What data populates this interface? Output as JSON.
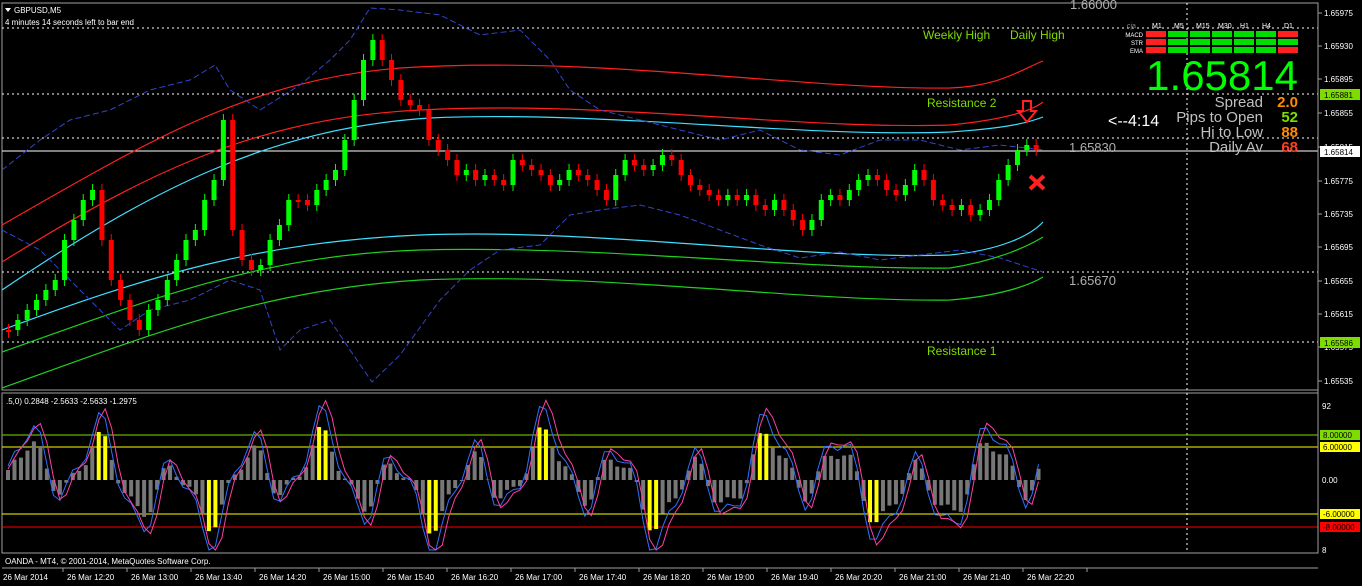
{
  "window": {
    "symbol_label": "GBPUSD,M5",
    "timer_text": "4 minutes 14 seconds left to bar end",
    "footer_text": "OANDA - MT4, © 2001-2014, MetaQuotes Software Corp."
  },
  "main_chart": {
    "price_labels": [
      "1.65975",
      "1.65930",
      "1.65895",
      "1.65855",
      "1.65815",
      "1.65775",
      "1.65735",
      "1.65695",
      "1.65655",
      "1.65615",
      "1.65575",
      "1.65535"
    ],
    "highlight_prices": [
      {
        "text": "1.65881",
        "color": "#7fdc00"
      },
      {
        "text": "1.65814",
        "color": "#ffffff"
      },
      {
        "text": "1.65586",
        "color": "#7fdc00"
      }
    ],
    "level_texts": {
      "top": "1.66000",
      "mid_high": "1.65830",
      "mid_low": "1.65670"
    },
    "labels": {
      "weekly_high": "Weekly High",
      "daily_high": "Daily High",
      "resistance_2": "Resistance 2",
      "resistance_1": "Resistance 1"
    },
    "colors": {
      "bull": "#00ff00",
      "bear": "#ff0000",
      "band_red": "#ff2020",
      "band_cyan": "#40e0ff",
      "band_green": "#20d020",
      "envelope": "#3344cc",
      "level_green": "#7fdc00"
    }
  },
  "info_panel": {
    "big_price": "1.65814",
    "countdown": "<--4:14",
    "rows": [
      {
        "label": "Spread",
        "value": "2.0",
        "color": "#ff8c00"
      },
      {
        "label": "Pips to Open",
        "value": "52",
        "color": "#7fdc00"
      },
      {
        "label": "Hi to Low",
        "value": "88",
        "color": "#ff8c00"
      },
      {
        "label": "Daily Av",
        "value": "68",
        "color": "#ff4020"
      }
    ]
  },
  "signal_grid": {
    "corner": "cja",
    "timeframes": [
      "M1",
      "M5",
      "M15",
      "M30",
      "H1",
      "H4",
      "D1"
    ],
    "rows": [
      {
        "name": "MACD",
        "cells": [
          "red",
          "green",
          "green",
          "green",
          "green",
          "green",
          "red"
        ]
      },
      {
        "name": "STR",
        "cells": [
          "red",
          "green",
          "green",
          "green",
          "green",
          "green",
          "green"
        ]
      },
      {
        "name": "EMA",
        "cells": [
          "red",
          "green",
          "green",
          "green",
          "green",
          "green",
          "red"
        ]
      }
    ]
  },
  "sub_chart": {
    "title": ".5,0) 0.2848 -2.5633 -2.5633 -1.2975",
    "scale_labels": [
      "92",
      "0.00",
      "8"
    ],
    "level_labels": [
      {
        "text": "8.00000",
        "color": "#7fdc00"
      },
      {
        "text": "6.00000",
        "color": "#ffff00"
      },
      {
        "text": "-6.00000",
        "color": "#ffff00"
      },
      {
        "text": "-8.00000",
        "color": "#ff0000"
      }
    ]
  },
  "time_axis": {
    "labels": [
      "26 Mar 2014",
      "26 Mar 12:20",
      "26 Mar 13:00",
      "26 Mar 13:40",
      "26 Mar 14:20",
      "26 Mar 15:00",
      "26 Mar 15:40",
      "26 Mar 16:20",
      "26 Mar 17:00",
      "26 Mar 17:40",
      "26 Mar 18:20",
      "26 Mar 19:00",
      "26 Mar 19:40",
      "26 Mar 20:20",
      "26 Mar 21:00",
      "26 Mar 21:40",
      "26 Mar 22:20"
    ]
  }
}
